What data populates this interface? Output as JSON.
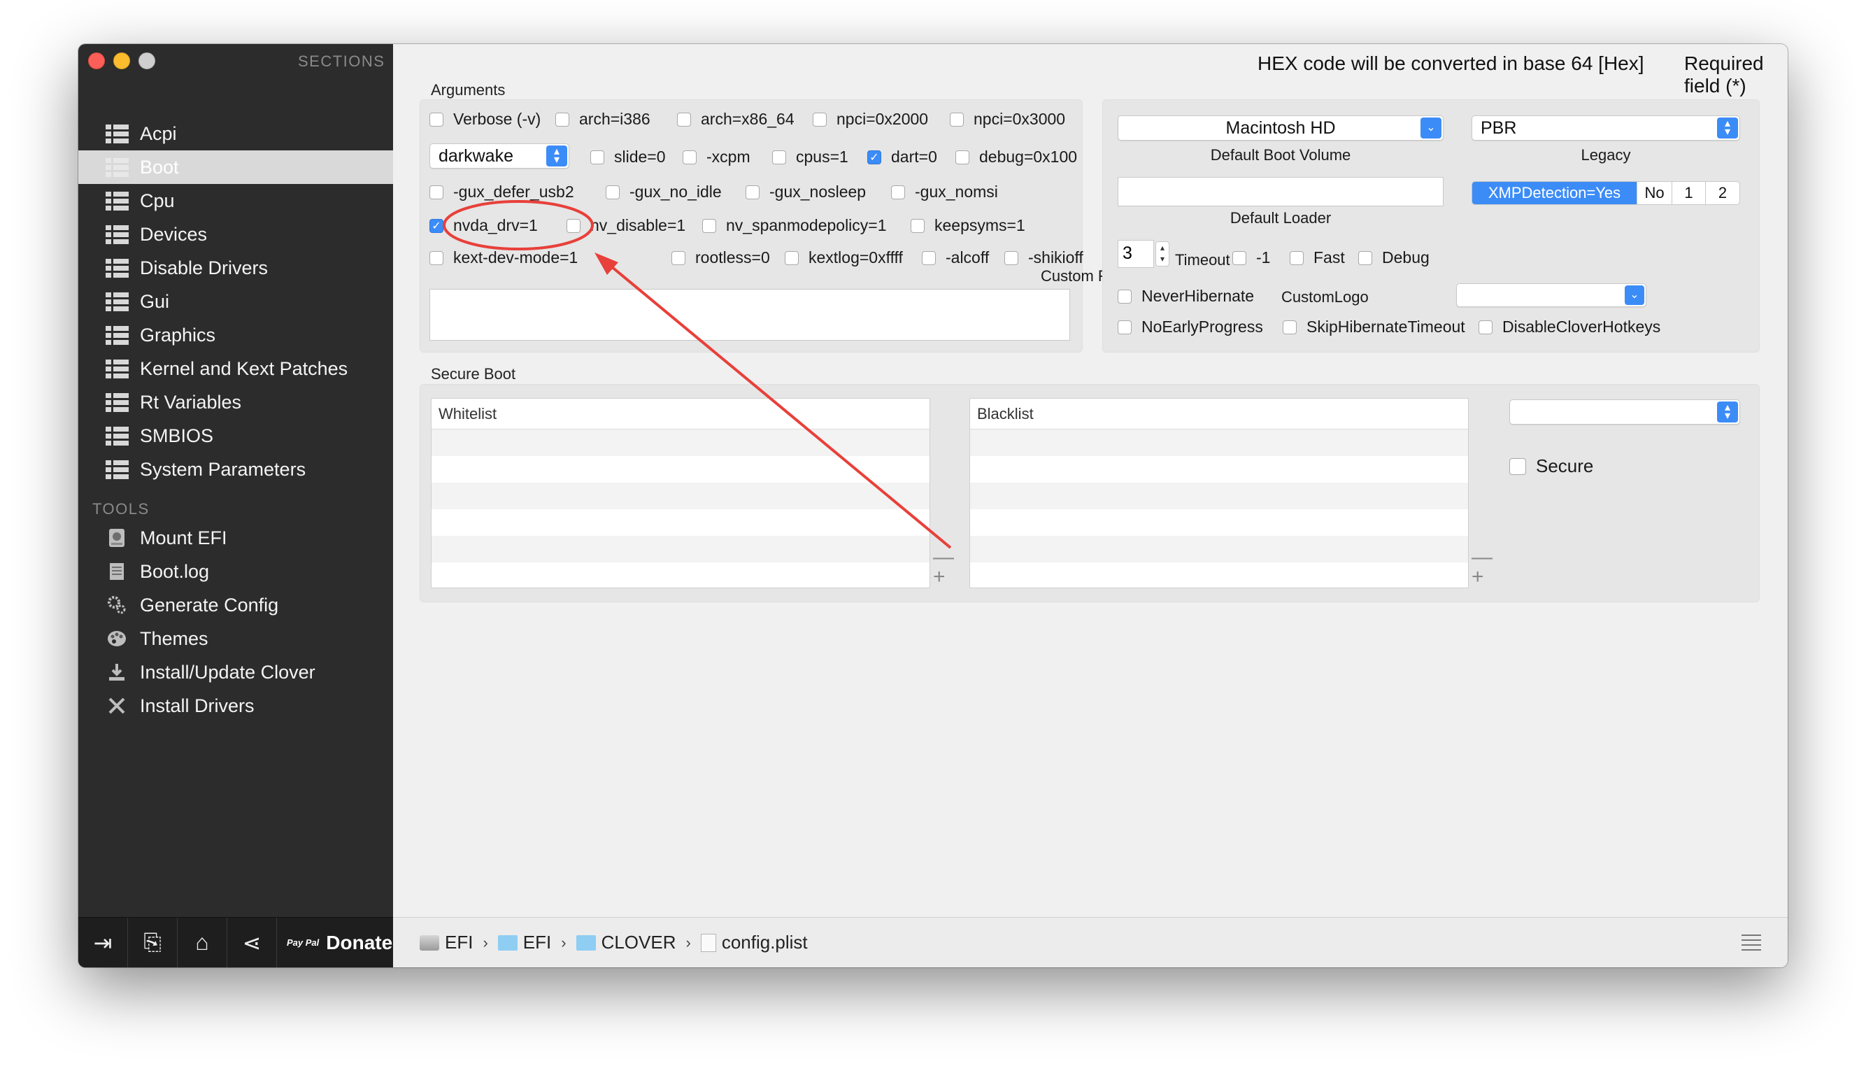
{
  "window": {
    "header_left": "HEX code will be converted in base 64 [Hex]",
    "header_right": "Required field (*)"
  },
  "sidebar": {
    "sections_header": "SECTIONS",
    "items": [
      {
        "label": "Acpi"
      },
      {
        "label": "Boot"
      },
      {
        "label": "Cpu"
      },
      {
        "label": "Devices"
      },
      {
        "label": "Disable Drivers"
      },
      {
        "label": "Gui"
      },
      {
        "label": "Graphics"
      },
      {
        "label": "Kernel and Kext Patches"
      },
      {
        "label": "Rt Variables"
      },
      {
        "label": "SMBIOS"
      },
      {
        "label": "System Parameters"
      }
    ],
    "selected": "Boot",
    "tools_header": "TOOLS",
    "tools": [
      {
        "label": "Mount EFI",
        "icon": "disk-icon"
      },
      {
        "label": "Boot.log",
        "icon": "log-icon"
      },
      {
        "label": "Generate Config",
        "icon": "gears-icon"
      },
      {
        "label": "Themes",
        "icon": "palette-icon"
      },
      {
        "label": "Install/Update Clover",
        "icon": "download-icon"
      },
      {
        "label": "Install Drivers",
        "icon": "wrench-icon"
      }
    ],
    "bottom": {
      "donate_label": "Donate",
      "paypal_mark": "Pay Pal"
    }
  },
  "arguments": {
    "title": "Arguments",
    "row1": [
      {
        "label": "Verbose (-v)",
        "checked": false
      },
      {
        "label": "arch=i386",
        "checked": false
      },
      {
        "label": "arch=x86_64",
        "checked": false
      },
      {
        "label": "npci=0x2000",
        "checked": false
      },
      {
        "label": "npci=0x3000",
        "checked": false
      }
    ],
    "darkwake_value": "darkwake",
    "row2": [
      {
        "label": "slide=0",
        "checked": false
      },
      {
        "label": "-xcpm",
        "checked": false
      },
      {
        "label": "cpus=1",
        "checked": false
      },
      {
        "label": "dart=0",
        "checked": true
      },
      {
        "label": "debug=0x100",
        "checked": false
      }
    ],
    "row3": [
      {
        "label": "-gux_defer_usb2",
        "checked": false
      },
      {
        "label": "-gux_no_idle",
        "checked": false
      },
      {
        "label": "-gux_nosleep",
        "checked": false
      },
      {
        "label": "-gux_nomsi",
        "checked": false
      }
    ],
    "row4": [
      {
        "label": "nvda_drv=1",
        "checked": true
      },
      {
        "label": "nv_disable=1",
        "checked": false
      },
      {
        "label": "nv_spanmodepolicy=1",
        "checked": false
      },
      {
        "label": "keepsyms=1",
        "checked": false
      }
    ],
    "row5": [
      {
        "label": "kext-dev-mode=1",
        "checked": false
      },
      {
        "label": "rootless=0",
        "checked": false
      },
      {
        "label": "kextlog=0xffff",
        "checked": false
      },
      {
        "label": "-alcoff",
        "checked": false
      },
      {
        "label": "-shikioff",
        "checked": false
      }
    ],
    "custom_flags_label": "Custom Flags",
    "custom_flags_value": ""
  },
  "boot_options": {
    "default_boot_volume": "Macintosh HD",
    "default_boot_volume_label": "Default Boot Volume",
    "legacy_value": "PBR",
    "legacy_label": "Legacy",
    "default_loader_label": "Default Loader",
    "default_loader_value": "",
    "xmp_segments": [
      "XMPDetection=Yes",
      "No",
      "1",
      "2"
    ],
    "xmp_selected": "XMPDetection=Yes",
    "timeout_value": "3",
    "timeout_label": "Timeout",
    "minus_one_label": "-1",
    "fast_label": "Fast",
    "debug_label": "Debug",
    "never_hibernate_label": "NeverHibernate",
    "custom_logo_label": "CustomLogo",
    "no_early_progress_label": "NoEarlyProgress",
    "skip_hibernate_label": "SkipHibernateTimeout",
    "disable_clover_hotkeys_label": "DisableCloverHotkeys"
  },
  "secure_boot": {
    "title": "Secure Boot",
    "whitelist_header": "Whitelist",
    "blacklist_header": "Blacklist",
    "secure_label": "Secure",
    "minus": "—",
    "plus": "+"
  },
  "pathbar": {
    "crumbs": [
      "EFI",
      "EFI",
      "CLOVER",
      "config.plist"
    ],
    "separator": "›"
  },
  "annotation": {
    "color": "#e8403a"
  }
}
